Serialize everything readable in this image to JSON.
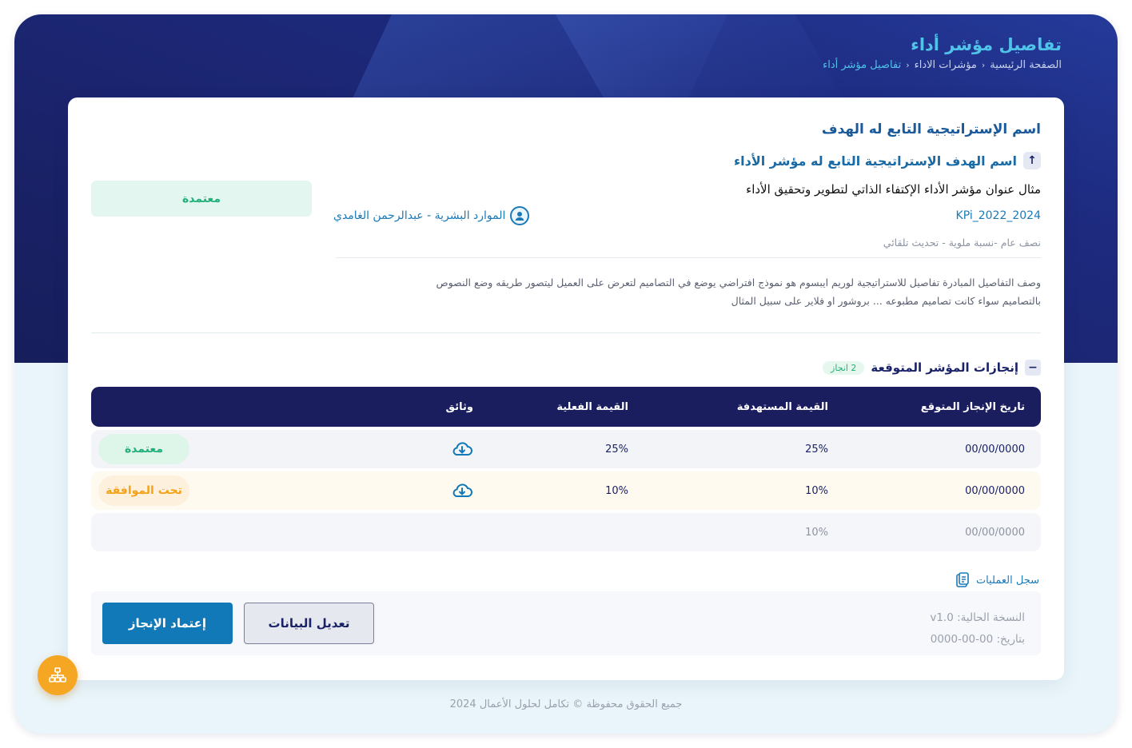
{
  "header": {
    "page_title": "تفاصيل مؤشر أداء",
    "breadcrumb": [
      "الصفحة الرئيسية",
      "مؤشرات الاداء",
      "تفاصيل مؤشر أداء"
    ]
  },
  "kpi": {
    "strategy_name": "اسم  الإستراتيجية التابع له الهدف",
    "goal_name": "اسم الهدف الإستراتيجية التابع له مؤشر الأداء",
    "title": "مثال عنوان مؤشر الأداء الإكتفاء الذاتي لتطوير وتحقيق الأداء",
    "code": "KPi_2022_2024",
    "meta": "نصف عام -نسبة ملوية - تحديث تلقائي",
    "owner": "الموارد البشرية - عبدالرحمن الغامدي",
    "status": "معتمدة",
    "description_line1": "وصف التفاصيل المبادرة تفاصيل للاستراتيجية لوريم ايبسوم هو نموذج افتراضي يوضع في التصاميم لتعرض على العميل ليتصور طريقه وضع النصوص",
    "description_line2": "بالتصاميم سواء كانت تصاميم مطبوعه ... بروشور او فلاير على سبيل المثال"
  },
  "achievements": {
    "title": "إنجازات المؤشر المتوقعة",
    "count_badge": "2 انجاز",
    "columns": {
      "date": "تاريخ الإنجاز المتوقع",
      "target": "القيمة المستهدفة",
      "actual": "القيمة الفعلية",
      "docs": "وثائق"
    },
    "rows": [
      {
        "date": "00/00/0000",
        "target": "25%",
        "actual": "25%",
        "status": "معتمدة"
      },
      {
        "date": "00/00/0000",
        "target": "10%",
        "actual": "10%",
        "status": "تحت الموافقة"
      },
      {
        "date": "00/00/0000",
        "target": "10%"
      }
    ]
  },
  "operations_log": "سجل العمليات",
  "version": {
    "current": "النسخة الحالية: v1.0",
    "date": "بتاريخ: 00-00-0000"
  },
  "buttons": {
    "approve": "إعتماد الإنجاز",
    "edit": "تعديل البيانات"
  },
  "footer": {
    "copyright": "جميع الحقوق محفوظة © تكامل لحلول الأعمال 2024"
  },
  "colors": {
    "primary": "#1a1d5e",
    "accent": "#1279b8",
    "success": "#22b07a",
    "warning": "#f3a21a",
    "fab": "#f5a623"
  }
}
